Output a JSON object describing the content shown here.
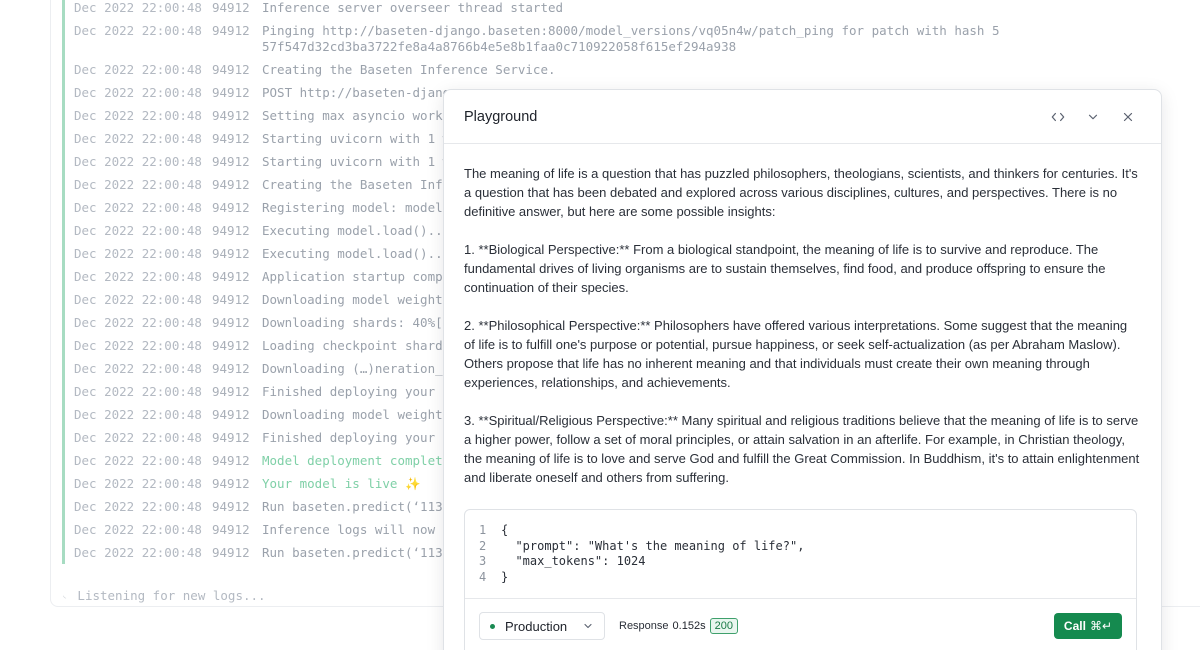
{
  "logs": [
    {
      "ts": "Dec 2022 22:00:48",
      "pid": "94912",
      "msg": "Inference server overseer thread started",
      "kind": "normal"
    },
    {
      "ts": "Dec 2022 22:00:48",
      "pid": "94912",
      "msg": "Pinging http://baseten-django.baseten:8000/model_versions/vq05n4w/patch_ping for patch with hash 557f547d32cd3ba3722fe8a4a8766b4e5e8b1faa0c710922058f615ef294a938",
      "kind": "normal"
    },
    {
      "ts": "Dec 2022 22:00:48",
      "pid": "94912",
      "msg": "Creating the Baseten Inference Service.",
      "kind": "normal"
    },
    {
      "ts": "Dec 2022 22:00:48",
      "pid": "94912",
      "msg": "POST http://baseten-djang",
      "kind": "normal"
    },
    {
      "ts": "Dec 2022 22:00:48",
      "pid": "94912",
      "msg": "Setting max asyncio worke",
      "kind": "normal"
    },
    {
      "ts": "Dec 2022 22:00:48",
      "pid": "94912",
      "msg": "Starting uvicorn with 1 w",
      "kind": "normal"
    },
    {
      "ts": "Dec 2022 22:00:48",
      "pid": "94912",
      "msg": "Starting uvicorn with 1 w",
      "kind": "normal"
    },
    {
      "ts": "Dec 2022 22:00:48",
      "pid": "94912",
      "msg": "Creating the Baseten Infe",
      "kind": "normal"
    },
    {
      "ts": "Dec 2022 22:00:48",
      "pid": "94912",
      "msg": "Registering model: model",
      "kind": "normal"
    },
    {
      "ts": "Dec 2022 22:00:48",
      "pid": "94912",
      "msg": "Executing model.load()...",
      "kind": "normal"
    },
    {
      "ts": "Dec 2022 22:00:48",
      "pid": "94912",
      "msg": "Executing model.load()...",
      "kind": "normal"
    },
    {
      "ts": "Dec 2022 22:00:48",
      "pid": "94912",
      "msg": "Application startup compl",
      "kind": "normal"
    },
    {
      "ts": "Dec 2022 22:00:48",
      "pid": "94912",
      "msg": "Downloading model weights",
      "kind": "normal"
    },
    {
      "ts": "Dec 2022 22:00:48",
      "pid": "94912",
      "msg": "Downloading shards: 40%[-",
      "kind": "normal"
    },
    {
      "ts": "Dec 2022 22:00:48",
      "pid": "94912",
      "msg": "Loading checkpoint shards",
      "kind": "normal"
    },
    {
      "ts": "Dec 2022 22:00:48",
      "pid": "94912",
      "msg": "Downloading (…)neration_c",
      "kind": "normal"
    },
    {
      "ts": "Dec 2022 22:00:48",
      "pid": "94912",
      "msg": "Finished deploying your m",
      "kind": "normal"
    },
    {
      "ts": "Dec 2022 22:00:48",
      "pid": "94912",
      "msg": "Downloading model weights",
      "kind": "normal"
    },
    {
      "ts": "Dec 2022 22:00:48",
      "pid": "94912",
      "msg": "Finished deploying your m",
      "kind": "normal"
    },
    {
      "ts": "Dec 2022 22:00:48",
      "pid": "94912",
      "msg": "Model deployment complete",
      "kind": "success"
    },
    {
      "ts": "Dec 2022 22:00:48",
      "pid": "94912",
      "msg": "Your model is live ✨",
      "kind": "success"
    },
    {
      "ts": "Dec 2022 22:00:48",
      "pid": "94912",
      "msg": "Run baseten.predict(‘1133",
      "kind": "normal"
    },
    {
      "ts": "Dec 2022 22:00:48",
      "pid": "94912",
      "msg": "Inference logs will now p",
      "kind": "normal"
    },
    {
      "ts": "Dec 2022 22:00:48",
      "pid": "94912",
      "msg": "Run baseten.predict(‘1133",
      "kind": "normal"
    }
  ],
  "listening": "Listening for new logs...",
  "playground": {
    "title": "Playground",
    "icons": [
      "code-icon",
      "chevron-down-icon",
      "close-icon"
    ],
    "paragraphs": [
      "The meaning of life is a question that has puzzled philosophers, theologians, scientists, and thinkers for centuries. It's a question that has been debated and explored across various disciplines, cultures, and perspectives. There is no definitive answer, but here are some possible insights:",
      "1.  **Biological Perspective:** From a biological standpoint, the meaning of life is to survive and reproduce. The fundamental drives of living organisms are to sustain themselves, find food, and produce offspring to ensure the continuation of their species.",
      "2.  **Philosophical Perspective:** Philosophers have offered various interpretations. Some suggest that the meaning of life is to fulfill one's purpose or potential, pursue happiness, or seek self-actualization (as per Abraham Maslow). Others propose that life has no inherent meaning and that individuals must create their own meaning through experiences, relationships, and achievements.",
      "3.  **Spiritual/Religious Perspective:** Many spiritual and religious traditions believe that the meaning of life is to serve a higher power, follow a set of moral principles, or attain salvation in an afterlife. For example, in Christian theology, the meaning of life is to love and serve God and fulfill the Great Commission. In Buddhism, it's to attain enlightenment and liberate oneself and others from suffering."
    ],
    "code_lines": [
      {
        "n": "1",
        "text": "{"
      },
      {
        "n": "2",
        "text": "  \"prompt\": \"What's the meaning of life?\","
      },
      {
        "n": "3",
        "text": "  \"max_tokens\": 1024"
      },
      {
        "n": "4",
        "text": "}"
      }
    ],
    "environment": "Production",
    "response_label": "Response",
    "response_time": "0.152s",
    "status_code": "200",
    "call_label": "Call",
    "call_shortcut": "⌘↵",
    "accent_color": "#158a4f"
  }
}
